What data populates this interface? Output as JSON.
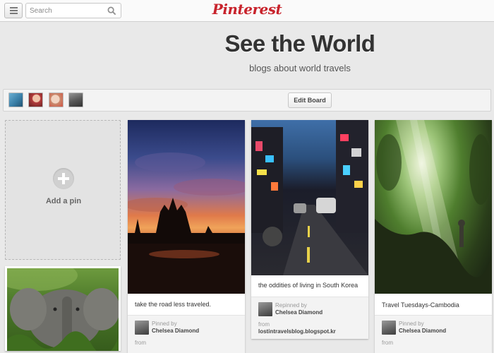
{
  "header": {
    "logo": "Pinterest",
    "search_placeholder": "Search"
  },
  "board": {
    "title": "See the World",
    "description": "blogs about world travels",
    "edit_label": "Edit Board",
    "collaborator_colors": [
      "#3a7fa8",
      "#b33b3b",
      "#c98a6e",
      "#5a5a5a"
    ]
  },
  "add_pin": {
    "label": "Add a pin"
  },
  "pins": [
    {
      "description": "take the road less traveled.",
      "via": "Pinned by",
      "pinner": "Chelsea Diamond",
      "from_label": "from",
      "source": ""
    },
    {
      "description": "the oddities of living in South Korea",
      "via": "Repinned by",
      "pinner": "Chelsea Diamond",
      "from_label": "from",
      "source": "lostintravelsblog.blogspot.kr"
    },
    {
      "description": "Travel Tuesdays-Cambodia",
      "via": "Pinned by",
      "pinner": "Chelsea Diamond",
      "from_label": "from",
      "source": ""
    }
  ],
  "colors": {
    "brand": "#c8232c",
    "background": "#e9e9e9"
  }
}
